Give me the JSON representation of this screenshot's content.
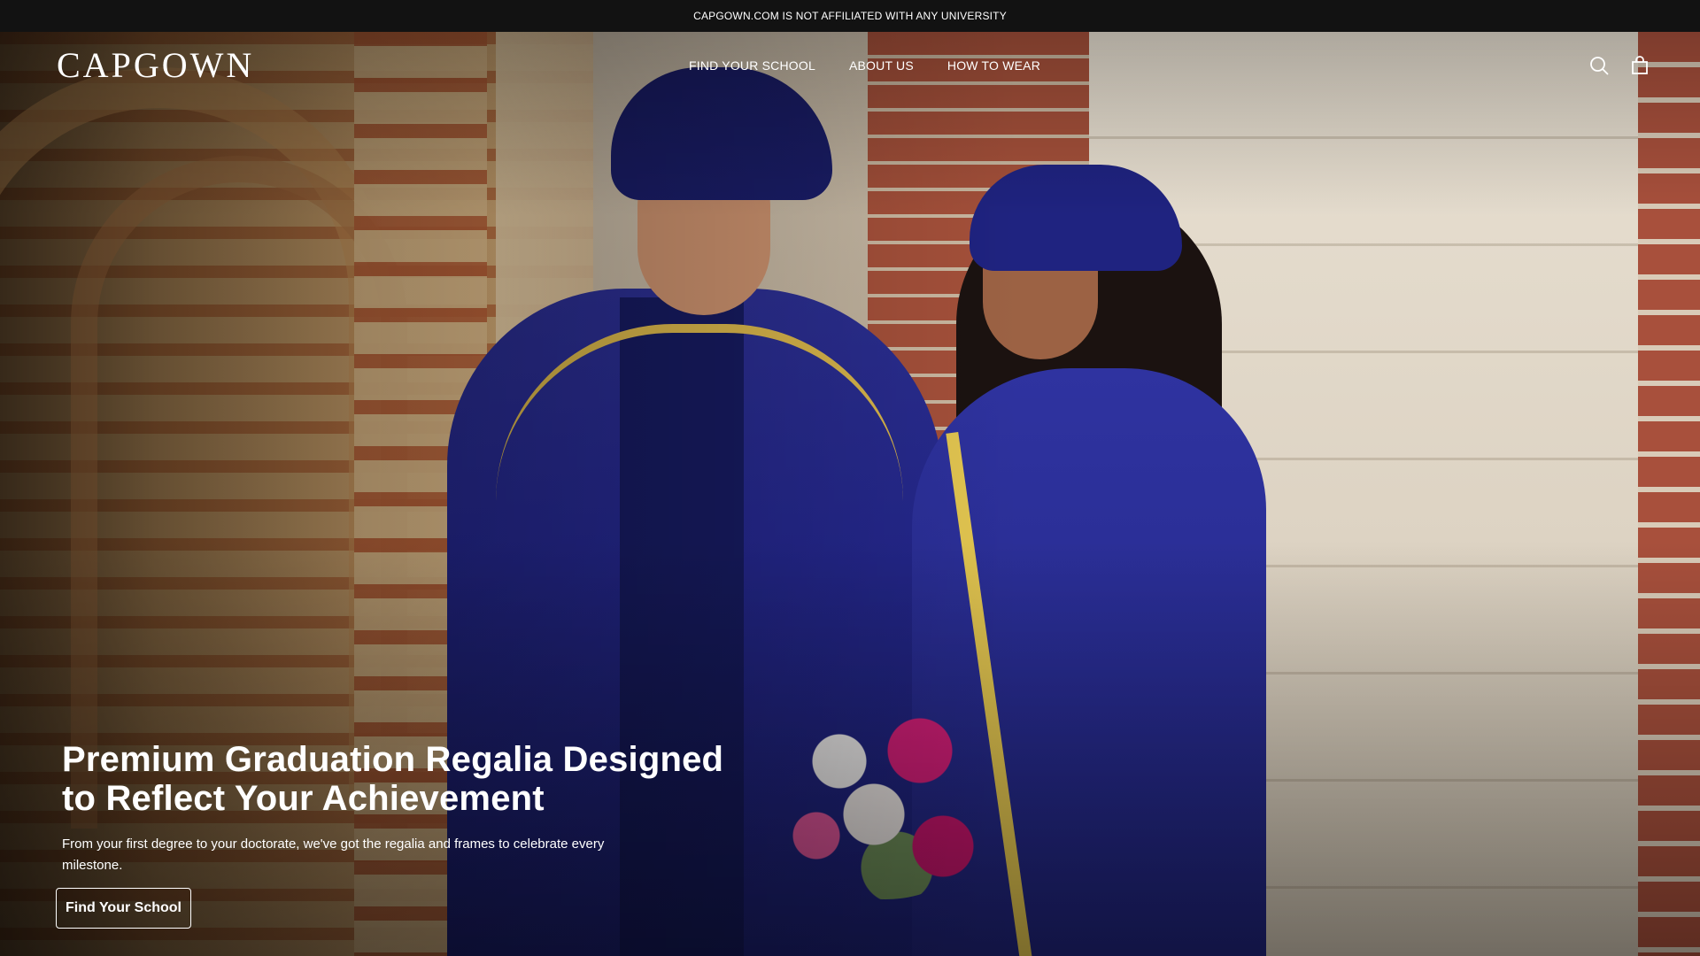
{
  "announcement": {
    "text": "CAPGOWN.COM IS NOT AFFILIATED WITH ANY UNIVERSITY"
  },
  "header": {
    "logo": "CAPGOWN",
    "nav": [
      {
        "label": "FIND YOUR SCHOOL"
      },
      {
        "label": "ABOUT US"
      },
      {
        "label": "HOW TO WEAR"
      }
    ],
    "icons": [
      "search-icon",
      "shopping-bag-icon"
    ]
  },
  "hero": {
    "title_line1": "Premium Graduation Regalia Designed",
    "title_line2": "to Reflect Your Achievement",
    "subtitle": "From your first degree to your doctorate, we've got the regalia and frames to celebrate every milestone.",
    "cta_label": "Find Your School"
  },
  "colors": {
    "announcement_bg": "#121212",
    "text": "#ffffff",
    "gown_navy": "#23268a",
    "gold_trim": "#d7b44a"
  }
}
